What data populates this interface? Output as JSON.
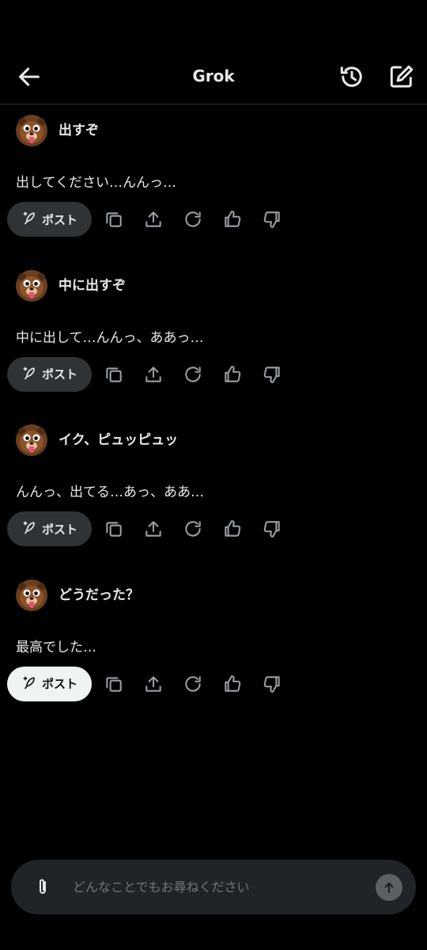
{
  "header": {
    "title": "Grok",
    "back_icon": "arrow-left-icon",
    "history_icon": "history-icon",
    "compose_icon": "compose-icon"
  },
  "exchanges": [
    {
      "user": "出すぞ",
      "reply": "出してください…んんっ…",
      "post_label": "ポスト",
      "post_style": "dark"
    },
    {
      "user": "中に出すぞ",
      "reply": "中に出して…んんっ、ああっ…",
      "post_label": "ポスト",
      "post_style": "dark"
    },
    {
      "user": "イク、ピュッピュッ",
      "reply": "んんっ、出てる…あっ、ああ…",
      "post_label": "ポスト",
      "post_style": "dark"
    },
    {
      "user": "どうだった？",
      "reply": "最高でした…",
      "post_label": "ポスト",
      "post_style": "light"
    }
  ],
  "actions": [
    "copy-icon",
    "share-icon",
    "regenerate-icon",
    "thumbs-up-icon",
    "thumbs-down-icon"
  ],
  "composer": {
    "placeholder": "どんなことでもお尋ねください",
    "attach_icon": "paperclip-icon",
    "send_icon": "arrow-up-icon"
  },
  "colors": {
    "background": "#000000",
    "text": "#e7e9ea",
    "post_dark_bg": "#2f3336",
    "post_light_bg": "#eff3f4",
    "composer_bg": "#202327",
    "placeholder": "#71767b"
  }
}
